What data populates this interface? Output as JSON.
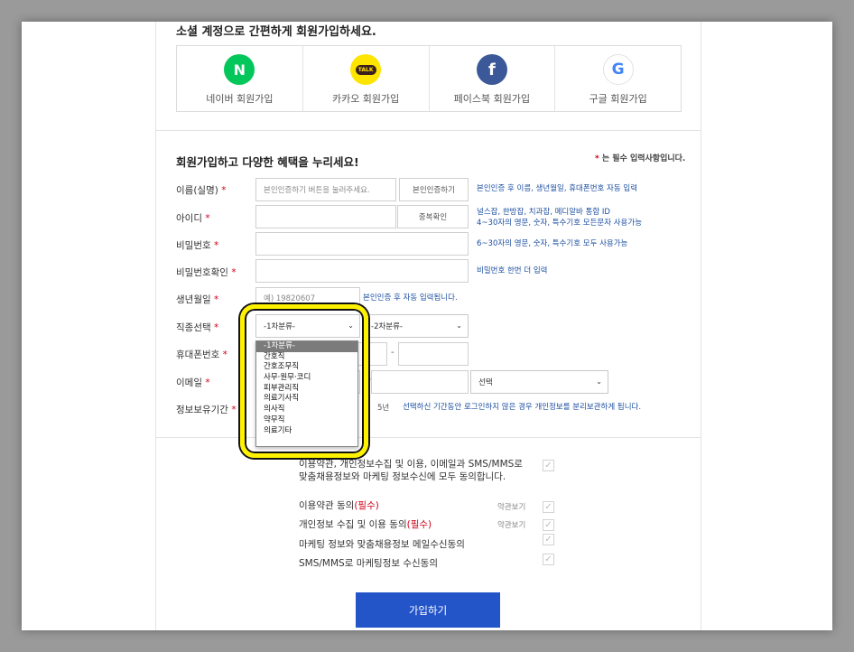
{
  "social": {
    "title": "소셜 계정으로 간편하게 회원가입하세요.",
    "items": [
      {
        "label": "네이버 회원가입",
        "glyph": "N",
        "color": "#03c75a",
        "icon": "naver-icon"
      },
      {
        "label": "카카오 회원가입",
        "glyph": "TALK",
        "color": "#fee500",
        "icon": "kakao-icon"
      },
      {
        "label": "페이스북 회원가입",
        "glyph": "f",
        "color": "#3b5998",
        "icon": "facebook-icon"
      },
      {
        "label": "구글 회원가입",
        "glyph": "G",
        "color": "#ffffff",
        "icon": "google-icon"
      }
    ]
  },
  "form": {
    "title": "회원가입하고 다양한 혜택을 누리세요!",
    "required_mark": "*",
    "required_note": "는 필수 입력사항입니다.",
    "name": {
      "label": "이름(실명)",
      "placeholder": "본인인증하기 버튼을 눌러주세요.",
      "button": "본인인증하기",
      "hint": "본인인증 후 이름, 생년월일, 휴대폰번호 자동 입력"
    },
    "id": {
      "label": "아이디",
      "button": "중복확인",
      "hint1": "널스잡, 한방잡, 치과잡, 메디알바 통합 ID",
      "hint2": "4~30자의 영문, 숫자, 특수기호 모든문자 사용가능"
    },
    "password": {
      "label": "비밀번호",
      "hint": "6~30자의 영문, 숫자, 특수기호 모두 사용가능"
    },
    "password_confirm": {
      "label": "비밀번호확인",
      "hint": "비밀번호 한번 더 입력"
    },
    "birth": {
      "label": "생년월일",
      "placeholder": "예) 19820607",
      "hint": "본인인증 후 자동 입력됩니다."
    },
    "job": {
      "label": "직종선택",
      "select1": "-1차분류-",
      "select2": "-2차분류-"
    },
    "phone": {
      "label": "휴대폰번호",
      "dash": "-"
    },
    "email": {
      "label": "이메일",
      "at": "@",
      "domain_select": "선택"
    },
    "retention": {
      "label": "정보보유기간",
      "value": "5년",
      "hint": "선택하신 기간동안 로그인하지 않은 경우 개인정보를 분리보관하게 됩니다."
    }
  },
  "dropdown": {
    "options": [
      "-1차분류-",
      "간호직",
      "간호조무직",
      "사무·원무·코디",
      "피부관리직",
      "의료기사직",
      "의사직",
      "약무직",
      "의료기타"
    ],
    "selected_index": 0
  },
  "agreements": {
    "all": {
      "line1": "이용약관, 개인정보수집 및 이용, 이메일과 SMS/MMS로",
      "line2": "맞춤채용정보와 마케팅 정보수신에 모두 동의합니다."
    },
    "items": [
      {
        "text": "이용약관 동의",
        "required": "(필수)",
        "view": "약관보기"
      },
      {
        "text": "개인정보 수집 및 이용 동의",
        "required": "(필수)",
        "view": "약관보기"
      },
      {
        "text": "마케팅 정보와 맞춤채용정보 메일수신동의",
        "required": "",
        "view": ""
      },
      {
        "text": "SMS/MMS로 마케팅정보 수신동의",
        "required": "",
        "view": ""
      }
    ],
    "check_glyph": "✓"
  },
  "submit_label": "가입하기",
  "colors": {
    "accent": "#2355c9",
    "hint": "#1e50a2",
    "required": "#d0021b",
    "highlight": "#fff200"
  }
}
